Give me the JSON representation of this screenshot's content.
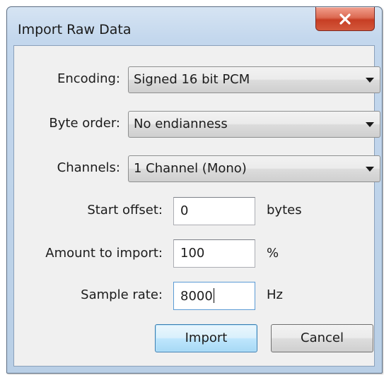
{
  "window": {
    "title": "Import Raw Data"
  },
  "fields": {
    "encoding": {
      "label": "Encoding:",
      "value": "Signed 16 bit PCM"
    },
    "byte_order": {
      "label": "Byte order:",
      "value": "No endianness"
    },
    "channels": {
      "label": "Channels:",
      "value": "1 Channel (Mono)"
    },
    "start_offset": {
      "label": "Start offset:",
      "value": "0",
      "unit": "bytes"
    },
    "amount": {
      "label": "Amount to import:",
      "value": "100",
      "unit": "%"
    },
    "sample_rate": {
      "label": "Sample rate:",
      "value": "8000",
      "unit": "Hz"
    }
  },
  "buttons": {
    "import": "Import",
    "cancel": "Cancel"
  },
  "icons": {
    "close": "close-icon",
    "dropdown": "chevron-down-icon"
  },
  "colors": {
    "close_button": "#c73e24",
    "default_button_border": "#3c7fb1",
    "frame": "#c3d7ed"
  }
}
